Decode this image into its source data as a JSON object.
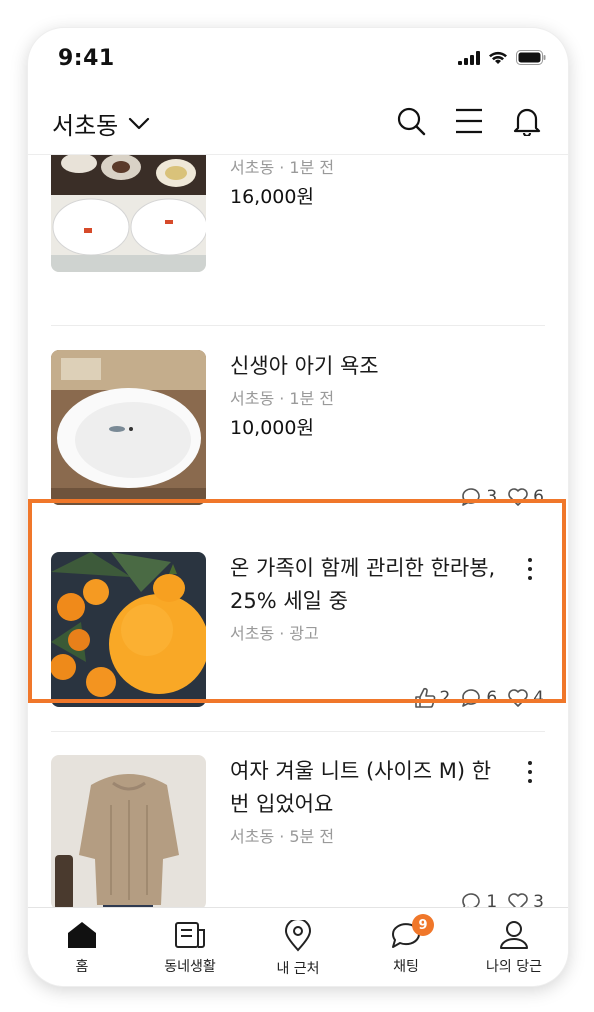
{
  "status_bar": {
    "time": "9:41"
  },
  "header": {
    "location": "서초동",
    "icons": [
      "search-icon",
      "menu-icon",
      "bell-icon"
    ]
  },
  "feed": {
    "items": [
      {
        "title": "",
        "meta": "서초동 · 1분 전",
        "price": "16,000원",
        "image": "white-plates-photo"
      },
      {
        "title": "신생아 아기 욕조",
        "meta": "서초동 · 1분 전",
        "price": "10,000원",
        "comments": "3",
        "likes": "6",
        "image": "baby-bathtub-photo"
      },
      {
        "title": "온 가족이 함께 관리한 한라봉, 25% 세일 중",
        "meta": "서초동 · 광고",
        "thumbs": "2",
        "comments": "6",
        "likes": "4",
        "image": "hallabong-orange-photo",
        "highlighted": true
      },
      {
        "title": "여자 겨울 니트 (사이즈 M) 한번 입었어요",
        "meta": "서초동 · 5분 전",
        "comments": "1",
        "likes": "3",
        "image": "knit-sweater-photo"
      }
    ]
  },
  "tabbar": {
    "tabs": [
      {
        "label": "홈",
        "icon": "home-icon",
        "active": true
      },
      {
        "label": "동네생활",
        "icon": "news-icon"
      },
      {
        "label": "내 근처",
        "icon": "location-pin-icon"
      },
      {
        "label": "채팅",
        "icon": "chat-icon",
        "badge": "9"
      },
      {
        "label": "나의 당근",
        "icon": "user-icon"
      }
    ]
  },
  "colors": {
    "accent": "#f0772a",
    "meta_text": "#9a9a9a",
    "divider": "#ececec"
  }
}
